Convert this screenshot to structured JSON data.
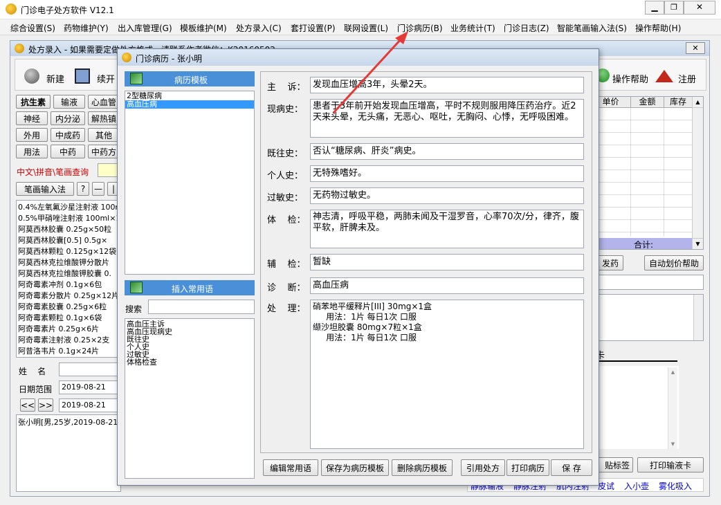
{
  "app": {
    "title": "门诊电子处方软件  V12.1"
  },
  "menu": [
    "综合设置(S)",
    "药物维护(Y)",
    "出入库管理(G)",
    "模板维护(M)",
    "处方录入(C)",
    "套打设置(P)",
    "联网设置(L)",
    "门诊病历(B)",
    "业务统计(T)",
    "门诊日志(Z)",
    "智能笔画输入法(S)",
    "操作帮助(H)"
  ],
  "rx": {
    "title": "处方录入 - 如果需要定做处方格式，请联系作者微信：K20160502",
    "new": "新建",
    "continue": "续开",
    "help": "操作帮助",
    "register": "注册",
    "cat_row1": [
      "抗生素",
      "输液",
      "心血管"
    ],
    "cat_row2": [
      "神经",
      "内分泌",
      "解热镇"
    ],
    "cat_row3": [
      "外用",
      "中成药",
      "其他"
    ],
    "cat_row4": [
      "用法",
      "中药",
      "中药方"
    ],
    "search_label": "中文\\拼音\\笔画查询",
    "stroke_btn": "笔画输入法",
    "small_btns": [
      "?",
      "—",
      "|"
    ],
    "drugs": [
      "0.4%左氧氟沙星注射液 100ml",
      "0.5%甲硝唑注射液 100ml×1",
      "阿莫西林胶囊 0.25g×50粒",
      "阿莫西林胶囊[0.5] 0.5g×",
      "阿莫西林颗粒 0.125g×12袋",
      "阿莫西林克拉维酸钾分散片",
      "阿莫西林克拉维酸钾胶囊 0.",
      "阿奇霉素冲剂 0.1g×6包",
      "阿奇霉素分散片 0.25g×12片",
      "阿奇霉素胶囊 0.25g×6粒",
      "阿奇霉素颗粒 0.1g×6袋",
      "阿奇霉素片 0.25g×6片",
      "阿奇霉素注射液 0.25×2支",
      "阿昔洛韦片 0.1g×24片"
    ],
    "name_label": "姓    名",
    "date_label": "日期范围",
    "date_from": "2019-08-21",
    "date_to": "2019-08-21",
    "nav_prev": "<<",
    "nav_next": ">>",
    "patient_row": "张小明[男,25岁,2019-08-21",
    "table_headers": [
      "单价",
      "金额",
      "库存"
    ],
    "total_label": "合计:",
    "dispense_btn": "发药",
    "auto_price_btn": "自动划价帮助",
    "card_label": "卡",
    "label_btn": "贴标签",
    "infusion_card_btn": "打印输液卡",
    "bottom_links": [
      "静脉输液",
      "静脉注射",
      "肌内注射",
      "皮试",
      "入小壶",
      "雾化吸入"
    ]
  },
  "dlg": {
    "title": "门诊病历 - 张小明",
    "template_header": "病历模板",
    "templates": [
      "2型糖尿病",
      "高血压病"
    ],
    "selected_template": 1,
    "phrase_header": "插入常用语",
    "search_label": "搜索",
    "search_value": "",
    "phrases": [
      "高血压主诉",
      "高血压现病史",
      "既往史",
      "个人史",
      "过敏史",
      "体格检查"
    ],
    "fields": [
      {
        "label": "主    诉：",
        "value": "发现血压增高3年，头晕2天。"
      },
      {
        "label": "现病史：",
        "value": "患者于3年前开始发现血压增高，平时不规则服用降压药治疗。近2天来头晕，无头痛，无恶心、呕吐，无胸闷、心悸，无呼吸困难。"
      },
      {
        "label": "既往史：",
        "value": "否认“糖尿病、肝炎”病史。"
      },
      {
        "label": "个人史：",
        "value": "无特殊嗜好。"
      },
      {
        "label": "过敏史：",
        "value": "无药物过敏史。"
      },
      {
        "label": "体    检：",
        "value": "神志清，呼吸平稳，两肺未闻及干湿罗音，心率70次/分，律齐，腹平软，肝脾未及。"
      },
      {
        "label": "辅    检：",
        "value": "暂缺"
      },
      {
        "label": "诊    断：",
        "value": "高血压病"
      }
    ],
    "treatment_label": "处    理：",
    "treatment": "硝苯地平缓释片[III] 30mg×1盒\n     用法：1片 每日1次 口服\n缬沙坦胶囊 80mg×7粒×1盒\n     用法：1片 每日1次 口服",
    "buttons": [
      "编辑常用语",
      "保存为病历模板",
      "删除病历模板",
      "引用处方",
      "打印病历",
      "保  存"
    ]
  },
  "colors": {
    "selected": "#3399ff",
    "header": "#4a90d9",
    "total_bar": "#b4b4ec",
    "arrow": "#e53935",
    "link": "#0000cc",
    "search_red": "#d40000"
  }
}
